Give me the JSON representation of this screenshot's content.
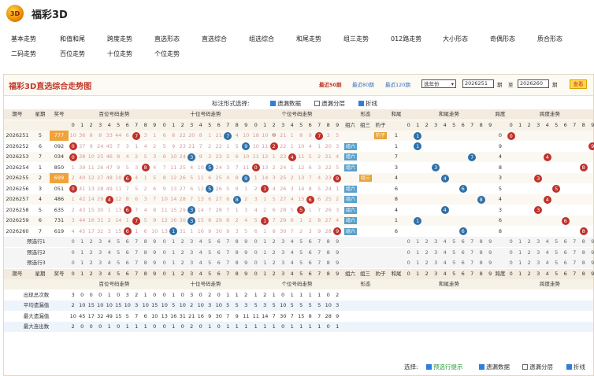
{
  "app": {
    "title": "福彩3D",
    "logo": "3D"
  },
  "nav": {
    "row1": [
      "基本走势",
      "和值和尾",
      "跨度走势",
      "直选形态",
      "直选综合",
      "组选综合",
      "和尾走势",
      "组三走势",
      "012路走势",
      "大小形态",
      "奇偶形态",
      "质合形态"
    ],
    "row2": [
      "二码走势",
      "百位走势",
      "十位走势",
      "个位走势"
    ]
  },
  "panel": {
    "title": "福彩3D直选综合走势图",
    "range": {
      "r50": "最近50期",
      "r80": "最近80期",
      "r120": "最近120期"
    },
    "year_select": "选年份",
    "from": "2026251",
    "sep1": "期",
    "to_label": "至",
    "to": "2026260",
    "sep2": "期",
    "query": "查看"
  },
  "options": {
    "label": "标注形式选择:",
    "o1": "遗漏数据",
    "o2": "遗漏分层",
    "o3": "折线"
  },
  "headers": {
    "issue": "期号",
    "week": "星期",
    "prize": "奖号",
    "bai": "百位号码走势",
    "shi": "十位号码走势",
    "ge": "个位号码走势",
    "xt": "形态",
    "zl": "组六",
    "zs": "组三",
    "bz": "豹子",
    "hw": "和尾",
    "hwh": "和尾走势",
    "kd": "跨度",
    "kdh": "跨度走势"
  },
  "rows": [
    {
      "issue": "2026251",
      "week": "5",
      "prize": "777",
      "b": [
        "10",
        "36",
        "8",
        "8",
        "33",
        "44",
        "6",
        "❼",
        "3",
        "1"
      ],
      "s": [
        "6",
        "8",
        "22",
        "20",
        "8",
        "1",
        "21",
        "❼",
        "4",
        "10"
      ],
      "g": [
        "18",
        "10",
        "❼",
        "21",
        "1",
        "8",
        "9",
        "❼",
        "3",
        "5"
      ],
      "form": "豹子"
    },
    {
      "issue": "2026252",
      "week": "6",
      "prize": "092",
      "b": [
        "0",
        "37",
        "9",
        "24",
        "45",
        "7",
        "3",
        "1",
        "4",
        "2"
      ],
      "s": [
        "5",
        "9",
        "23",
        "21",
        "7",
        "2",
        "22",
        "1",
        "5",
        "9"
      ],
      "g": [
        "10",
        "11",
        "2",
        "22",
        "1",
        "10",
        "4",
        "1",
        "20",
        "3"
      ],
      "form": "组六"
    },
    {
      "issue": "2026253",
      "week": "7",
      "prize": "034",
      "b": [
        "0",
        "38",
        "10",
        "25",
        "46",
        "8",
        "4",
        "2",
        "5",
        "3"
      ],
      "s": [
        "6",
        "10",
        "24",
        "3",
        "9",
        "3",
        "23",
        "2",
        "6",
        "10"
      ],
      "g": [
        "11",
        "12",
        "1",
        "23",
        "4",
        "11",
        "5",
        "2",
        "21",
        "4"
      ],
      "form": "组六"
    },
    {
      "issue": "2026254",
      "week": "1",
      "prize": "850",
      "b": [
        "1",
        "39",
        "11",
        "26",
        "47",
        "9",
        "5",
        "3",
        "8",
        "4"
      ],
      "s": [
        "7",
        "11",
        "25",
        "4",
        "10",
        "5",
        "24",
        "3",
        "7",
        "11"
      ],
      "g": [
        "0",
        "13",
        "2",
        "24",
        "1",
        "12",
        "6",
        "3",
        "22",
        "5"
      ],
      "form": "组六"
    },
    {
      "issue": "2026255",
      "week": "2",
      "prize": "699",
      "b": [
        "2",
        "40",
        "12",
        "27",
        "48",
        "10",
        "6",
        "4",
        "1",
        "5"
      ],
      "s": [
        "8",
        "12",
        "26",
        "5",
        "11",
        "6",
        "25",
        "4",
        "8",
        "9"
      ],
      "g": [
        "1",
        "14",
        "3",
        "25",
        "2",
        "13",
        "7",
        "4",
        "23",
        "9"
      ],
      "form": "组三"
    },
    {
      "issue": "2026256",
      "week": "3",
      "prize": "051",
      "b": [
        "0",
        "41",
        "13",
        "28",
        "49",
        "11",
        "7",
        "5",
        "2",
        "6"
      ],
      "s": [
        "9",
        "13",
        "27",
        "6",
        "12",
        "5",
        "26",
        "5",
        "9",
        "1"
      ],
      "g": [
        "2",
        "1",
        "4",
        "26",
        "3",
        "14",
        "8",
        "5",
        "24",
        "1"
      ],
      "form": "组六"
    },
    {
      "issue": "2026257",
      "week": "4",
      "prize": "486",
      "b": [
        "1",
        "42",
        "14",
        "29",
        "4",
        "12",
        "8",
        "6",
        "3",
        "7"
      ],
      "s": [
        "10",
        "14",
        "28",
        "7",
        "13",
        "6",
        "27",
        "6",
        "8",
        "2"
      ],
      "g": [
        "3",
        "1",
        "5",
        "27",
        "4",
        "15",
        "6",
        "6",
        "25",
        "2"
      ],
      "form": "组六"
    },
    {
      "issue": "2026258",
      "week": "5",
      "prize": "635",
      "b": [
        "2",
        "43",
        "15",
        "30",
        "1",
        "13",
        "6",
        "7",
        "4",
        "8"
      ],
      "s": [
        "11",
        "15",
        "29",
        "3",
        "14",
        "7",
        "28",
        "7",
        "1",
        "3"
      ],
      "g": [
        "4",
        "2",
        "6",
        "28",
        "5",
        "5",
        "1",
        "7",
        "26",
        "3"
      ],
      "form": "组六"
    },
    {
      "issue": "2026259",
      "week": "6",
      "prize": "731",
      "b": [
        "3",
        "44",
        "16",
        "31",
        "2",
        "14",
        "1",
        "7",
        "5",
        "9"
      ],
      "s": [
        "12",
        "16",
        "30",
        "3",
        "15",
        "8",
        "29",
        "8",
        "2",
        "4"
      ],
      "g": [
        "5",
        "1",
        "7",
        "29",
        "6",
        "1",
        "2",
        "8",
        "27",
        "4"
      ],
      "form": "组六"
    },
    {
      "issue": "2026260",
      "week": "7",
      "prize": "619",
      "b": [
        "4",
        "45",
        "17",
        "32",
        "3",
        "15",
        "6",
        "1",
        "6",
        "10"
      ],
      "s": [
        "13",
        "1",
        "31",
        "1",
        "16",
        "9",
        "30",
        "9",
        "3",
        "5"
      ],
      "g": [
        "6",
        "1",
        "8",
        "30",
        "7",
        "2",
        "3",
        "9",
        "28",
        "9"
      ],
      "form": "组六"
    }
  ],
  "balls": [
    {
      "b": 7,
      "s": 7,
      "g": 7
    },
    {
      "b": 0,
      "s": 9,
      "g": 2
    },
    {
      "b": 0,
      "s": 3,
      "g": 4
    },
    {
      "b": 8,
      "s": 5,
      "g": 0
    },
    {
      "b": 6,
      "s": 9,
      "g": 9
    },
    {
      "b": 0,
      "s": 5,
      "g": 1
    },
    {
      "b": 4,
      "s": 8,
      "g": 6
    },
    {
      "b": 6,
      "s": 3,
      "g": 5
    },
    {
      "b": 7,
      "s": 3,
      "g": 1
    },
    {
      "b": 6,
      "s": 1,
      "g": 9
    }
  ],
  "predict": [
    "预选行1",
    "预选行2",
    "预选行3"
  ],
  "digits": [
    "0",
    "1",
    "2",
    "3",
    "4",
    "5",
    "6",
    "7",
    "8",
    "9"
  ],
  "stats": [
    {
      "label": "出现总次数",
      "b": [
        "3",
        "0",
        "0",
        "0",
        "1",
        "0",
        "3",
        "2",
        "1",
        "0"
      ],
      "s": [
        "0",
        "1",
        "0",
        "3",
        "0",
        "2",
        "0",
        "1",
        "1",
        "2"
      ],
      "g": [
        "1",
        "2",
        "1",
        "0",
        "1",
        "1",
        "1",
        "1",
        "0",
        "2"
      ]
    },
    {
      "label": "平均遗漏值",
      "b": [
        "2",
        "10",
        "15",
        "10",
        "10",
        "15",
        "10",
        "3",
        "10",
        "15"
      ],
      "s": [
        "10",
        "5",
        "10",
        "2",
        "10",
        "3",
        "10",
        "5",
        "5",
        "3"
      ],
      "g": [
        "5",
        "3",
        "5",
        "10",
        "5",
        "5",
        "5",
        "5",
        "10",
        "3"
      ]
    },
    {
      "label": "最大遗漏值",
      "b": [
        "10",
        "45",
        "17",
        "32",
        "49",
        "15",
        "5",
        "7",
        "6",
        "10"
      ],
      "s": [
        "13",
        "16",
        "31",
        "21",
        "16",
        "9",
        "30",
        "7",
        "9",
        "11"
      ],
      "g": [
        "11",
        "14",
        "7",
        "30",
        "7",
        "15",
        "8",
        "7",
        "28",
        "9"
      ]
    },
    {
      "label": "最大连出数",
      "b": [
        "2",
        "0",
        "0",
        "0",
        "1",
        "0",
        "1",
        "1",
        "1",
        "0"
      ],
      "s": [
        "0",
        "1",
        "0",
        "2",
        "0",
        "1",
        "0",
        "1",
        "1",
        "1"
      ],
      "g": [
        "1",
        "1",
        "1",
        "0",
        "1",
        "1",
        "1",
        "1",
        "0",
        "1"
      ]
    }
  ],
  "footer": {
    "label": "选择:",
    "o1": "预选行提示",
    "o2": "遗漏数据",
    "o3": "遗漏分层",
    "o4": "折线"
  },
  "colors": {
    "red": "#c0302a",
    "blue": "#2e6fa7",
    "tag": "#5aa0c8"
  }
}
